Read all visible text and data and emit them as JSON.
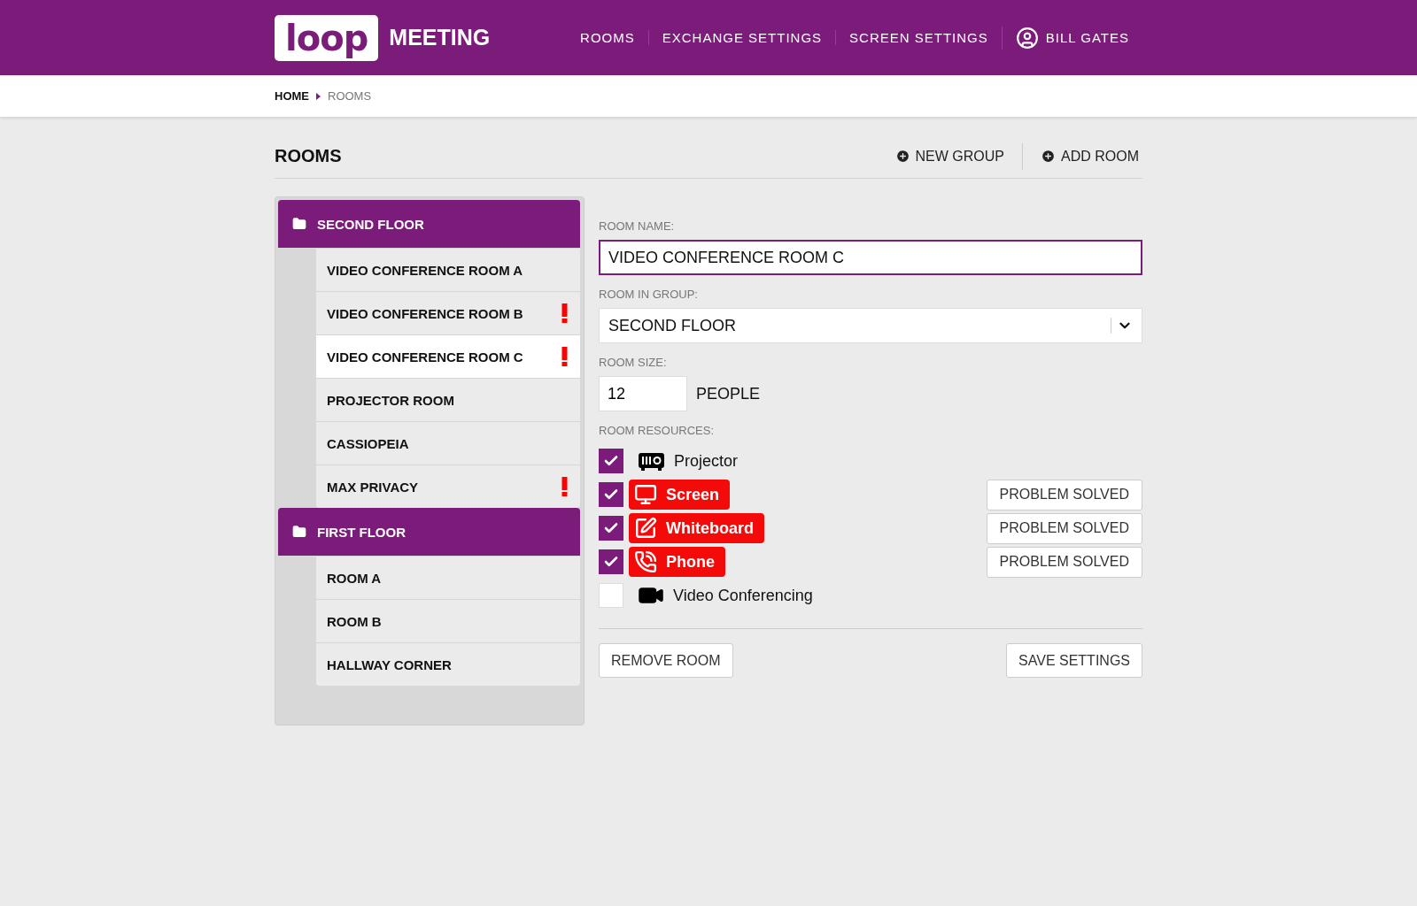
{
  "header": {
    "logo": "loop",
    "product": "MEETING",
    "nav": [
      "ROOMS",
      "EXCHANGE SETTINGS",
      "SCREEN SETTINGS"
    ],
    "user": "BILL GATES"
  },
  "breadcrumb": [
    "HOME",
    "ROOMS"
  ],
  "page": {
    "title": "ROOMS",
    "actions": [
      "NEW GROUP",
      "ADD ROOM"
    ]
  },
  "groups": [
    {
      "name": "SECOND FLOOR",
      "rooms": [
        {
          "name": "VIDEO CONFERENCE ROOM A",
          "selected": false,
          "alert": false
        },
        {
          "name": "VIDEO CONFERENCE ROOM B",
          "selected": false,
          "alert": true
        },
        {
          "name": "VIDEO CONFERENCE ROOM C",
          "selected": true,
          "alert": true
        },
        {
          "name": "PROJECTOR ROOM",
          "selected": false,
          "alert": false
        },
        {
          "name": "CASSIOPEIA",
          "selected": false,
          "alert": false
        },
        {
          "name": "MAX PRIVACY",
          "selected": false,
          "alert": true
        }
      ]
    },
    {
      "name": "FIRST FLOOR",
      "rooms": [
        {
          "name": "ROOM A",
          "selected": false,
          "alert": false
        },
        {
          "name": "ROOM B",
          "selected": false,
          "alert": false
        },
        {
          "name": "HALLWAY CORNER",
          "selected": false,
          "alert": false
        }
      ]
    }
  ],
  "form": {
    "name_label": "ROOM NAME:",
    "name_value": "VIDEO CONFERENCE ROOM C",
    "group_label": "ROOM IN GROUP:",
    "group_value": "SECOND FLOOR",
    "size_label": "ROOM SIZE:",
    "size_value": "12",
    "size_unit": "PEOPLE",
    "resources_label": "ROOM RESOURCES:",
    "resources": [
      {
        "kind": "projector",
        "label": "Projector",
        "checked": true,
        "problem": false
      },
      {
        "kind": "screen",
        "label": "Screen",
        "checked": true,
        "problem": true,
        "action": "PROBLEM SOLVED"
      },
      {
        "kind": "whiteboard",
        "label": "Whiteboard",
        "checked": true,
        "problem": true,
        "action": "PROBLEM SOLVED"
      },
      {
        "kind": "phone",
        "label": "Phone",
        "checked": true,
        "problem": true,
        "action": "PROBLEM SOLVED"
      },
      {
        "kind": "video",
        "label": "Video Conferencing",
        "checked": false,
        "problem": false
      }
    ],
    "buttons": [
      "REMOVE ROOM",
      "SAVE SETTINGS"
    ]
  }
}
